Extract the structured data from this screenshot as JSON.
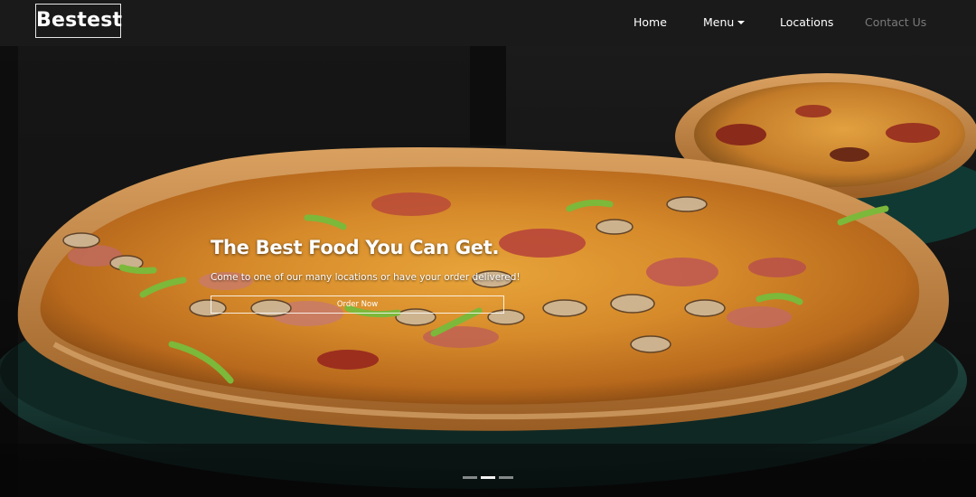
{
  "brand": {
    "name": "Bestest"
  },
  "nav": {
    "home": "Home",
    "menu": "Menu",
    "locations": "Locations",
    "contact": "Contact Us"
  },
  "hero": {
    "title": "The Best Food You Can Get.",
    "text": "Come to one of our many locations or have your order delivered!",
    "button": "Order Now"
  },
  "carousel": {
    "slide_count": 3,
    "active_index": 1
  },
  "colors": {
    "navbar": "#1a1a1a",
    "text": "#ffffff",
    "muted_link": "#7a7a7a"
  }
}
